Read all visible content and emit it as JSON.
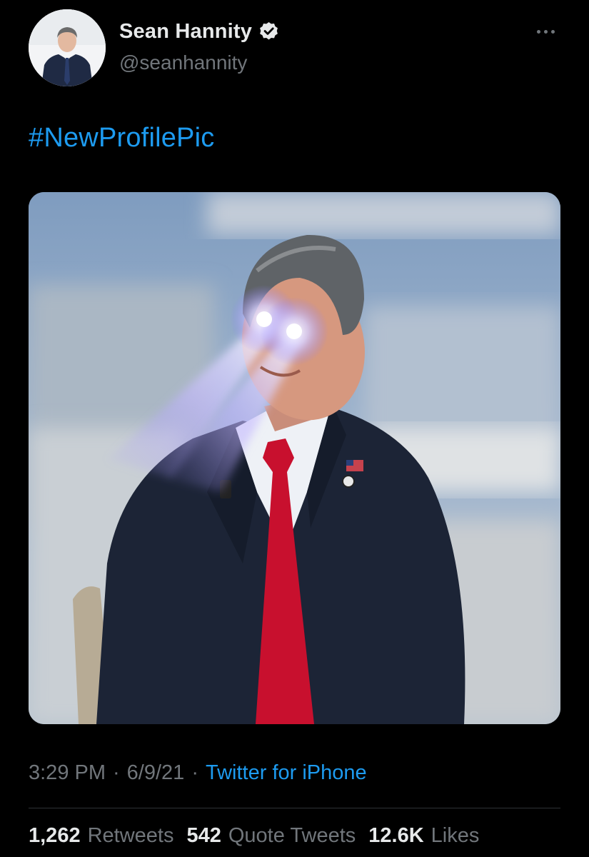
{
  "author": {
    "display_name": "Sean Hannity",
    "handle": "@seanhannity",
    "verified": true
  },
  "icons": {
    "verified": "verified-badge-icon",
    "more": "more-options-icon"
  },
  "tweet": {
    "text": "#NewProfilePic",
    "media": "photo"
  },
  "meta": {
    "time": "3:29 PM",
    "sep1": "·",
    "date": "6/9/21",
    "sep2": "·",
    "source": "Twitter for iPhone"
  },
  "stats": {
    "retweets": {
      "count": "1,262",
      "label": "Retweets"
    },
    "quotes": {
      "count": "542",
      "label": "Quote Tweets"
    },
    "likes": {
      "count": "12.6K",
      "label": "Likes"
    }
  },
  "colors": {
    "background": "#000000",
    "link": "#1d9bf0",
    "secondary_text": "#71767b",
    "primary_text": "#e7e9ea"
  }
}
